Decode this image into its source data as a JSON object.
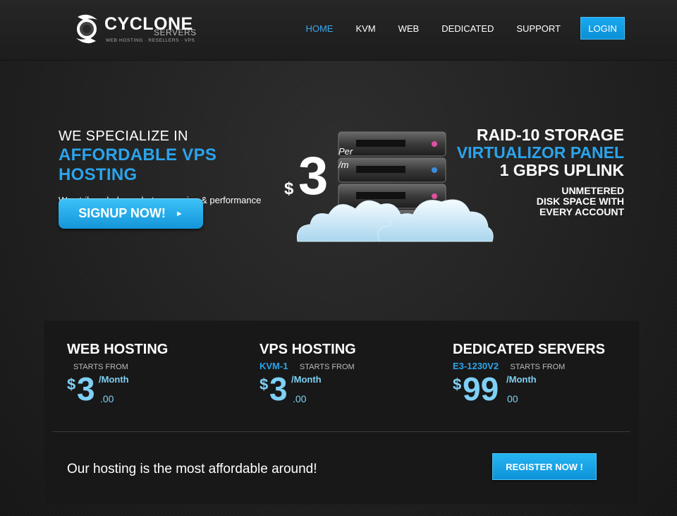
{
  "brand": {
    "name": "CYCLONE",
    "sub": "SERVERS",
    "tagline": "WEB HOSTING · RESELLERS · VPS"
  },
  "nav": {
    "items": [
      {
        "label": "HOME",
        "active": true
      },
      {
        "label": "KVM",
        "active": false
      },
      {
        "label": "WEB",
        "active": false
      },
      {
        "label": "DEDICATED",
        "active": false
      },
      {
        "label": "SUPPORT",
        "active": false
      }
    ],
    "login_label": "LOGIN"
  },
  "hero": {
    "line1": "WE SPECIALIZE IN",
    "line2": "AFFORDABLE VPS HOSTING",
    "subtitle": "We strike a balance between price & performance",
    "signup_label": "SIGNUP NOW!",
    "signup_arrow": "►",
    "price_currency": "$",
    "price_value": "3",
    "price_per": "Per",
    "price_period": "/m",
    "features": {
      "f1": "RAID-10 STORAGE",
      "f2": "VIRTUALIZOR PANEL",
      "f3": "1 GBPS UPLINK",
      "f4a": "UNMETERED",
      "f4b": "DISK SPACE WITH",
      "f4c": "EVERY ACCOUNT"
    }
  },
  "plans": [
    {
      "title": "WEB HOSTING",
      "sub": "",
      "starts": "STARTS FROM",
      "currency": "$",
      "price": "3",
      "period": "/Month",
      "cents": ".00"
    },
    {
      "title": "VPS HOSTING",
      "sub": "KVM-1",
      "starts": "STARTS FROM",
      "currency": "$",
      "price": "3",
      "period": "/Month",
      "cents": ".00"
    },
    {
      "title": "DEDICATED SERVERS",
      "sub": "E3-1230V2",
      "starts": "STARTS FROM",
      "currency": "$",
      "price": "99",
      "period": "/Month",
      "cents": "00"
    }
  ],
  "footer_panel": {
    "tagline": "Our hosting is the most affordable around!",
    "register_label": "REGISTER NOW !"
  },
  "colors": {
    "accent": "#2ba4ec",
    "price": "#7fd0f5",
    "background": "#1f1f1f"
  }
}
